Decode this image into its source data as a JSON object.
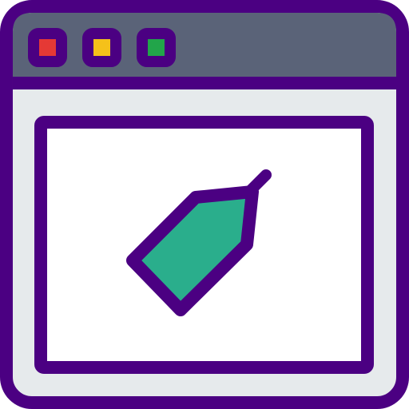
{
  "icon": {
    "name": "browser-window-with-price-tag",
    "colors": {
      "outline": "#4B0082",
      "title_bar": "#5A6378",
      "window_body": "#E6EAEC",
      "content_panel": "#FFFFFF",
      "tag_fill": "#2AAE8C",
      "control_red": "#E53935",
      "control_yellow": "#F5C11A",
      "control_green": "#22A54A"
    },
    "window_controls": [
      "close-control",
      "minimize-control",
      "maximize-control"
    ],
    "content_icon": "price-tag-icon"
  }
}
